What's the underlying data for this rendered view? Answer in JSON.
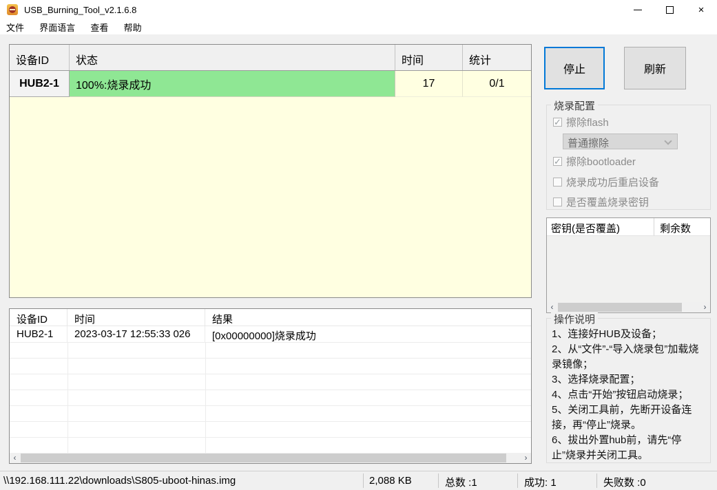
{
  "window": {
    "title": "USB_Burning_Tool_v2.1.6.8",
    "close_glyph": "×"
  },
  "menu": {
    "items": [
      {
        "label": "文件"
      },
      {
        "label": "界面语言"
      },
      {
        "label": "查看"
      },
      {
        "label": "帮助"
      }
    ]
  },
  "device_grid": {
    "headers": [
      "设备ID",
      "状态",
      "时间",
      "统计"
    ],
    "row": {
      "device": "HUB2-1",
      "status": "100%:烧录成功",
      "time": "17",
      "stat": "0/1"
    }
  },
  "actions": {
    "stop": "停止",
    "refresh": "刷新"
  },
  "burn_config": {
    "title": "烧录配置",
    "options": [
      {
        "label": "擦除flash",
        "checked": true
      },
      {
        "label": "擦除bootloader",
        "checked": true
      },
      {
        "label": "烧录成功后重启设备",
        "checked": false
      },
      {
        "label": "是否覆盖烧录密钥",
        "checked": false
      }
    ],
    "erase_mode": "普通擦除"
  },
  "key_table": {
    "col_key": "密钥(是否覆盖)",
    "col_remaining": "剩余数"
  },
  "instructions": {
    "title": "操作说明",
    "lines": [
      "1、连接好HUB及设备；",
      "2、从“文件”-“导入烧录包”加载烧录镜像；",
      "3、选择烧录配置；",
      "4、点击“开始”按钮启动烧录；",
      "5、关闭工具前，先断开设备连接，再“停止”烧录。",
      "6、拔出外置hub前，请先“停止”烧录并关闭工具。"
    ]
  },
  "log_grid": {
    "headers": [
      "设备ID",
      "时间",
      "结果"
    ],
    "row": {
      "device": "HUB2-1",
      "time": "2023-03-17 12:55:33 026",
      "result": "[0x00000000]烧录成功"
    }
  },
  "status_bar": {
    "path": "\\\\192.168.111.22\\downloads\\S805-uboot-hinas.img",
    "size": "2,088 KB",
    "total_label": "总数 :1",
    "success_label": "成功: 1",
    "failed_label": "失败数 :0"
  },
  "glyphs": {
    "check": "✓",
    "scroll_left": "‹",
    "scroll_right": "›"
  },
  "colors": {
    "accent": "#0078D7",
    "success_green": "#8FE794",
    "pending_cream": "#FFFFE1"
  }
}
